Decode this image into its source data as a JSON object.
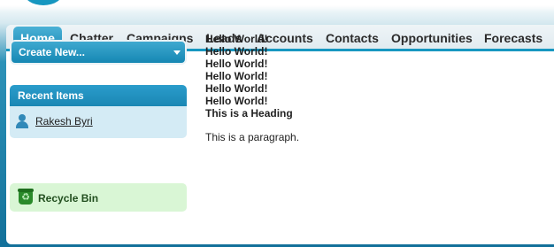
{
  "nav": {
    "tabs": [
      {
        "label": "Home"
      },
      {
        "label": "Chatter"
      },
      {
        "label": "Campaigns"
      },
      {
        "label": "Leads"
      },
      {
        "label": "Accounts"
      },
      {
        "label": "Contacts"
      },
      {
        "label": "Opportunities"
      },
      {
        "label": "Forecasts"
      }
    ],
    "active_tab": "Home"
  },
  "sidebar": {
    "create_new_label": "Create New...",
    "recent_items": {
      "title": "Recent Items",
      "items": [
        {
          "label": "Rakesh Byri",
          "icon": "person-icon"
        }
      ]
    },
    "recycle_bin": {
      "label": "Recycle Bin",
      "icon": "recycle-bin-icon"
    }
  },
  "main": {
    "lines": [
      "Hello World!",
      "Hello World!",
      "Hello World!",
      "Hello World!",
      "Hello World!",
      "Hello World!"
    ],
    "heading": "This is a Heading",
    "paragraph": "This is a paragraph."
  },
  "colors": {
    "brand_blue": "#1797c0",
    "recycle_green": "#d9f6d5",
    "recent_bg": "#d4ebf5"
  }
}
